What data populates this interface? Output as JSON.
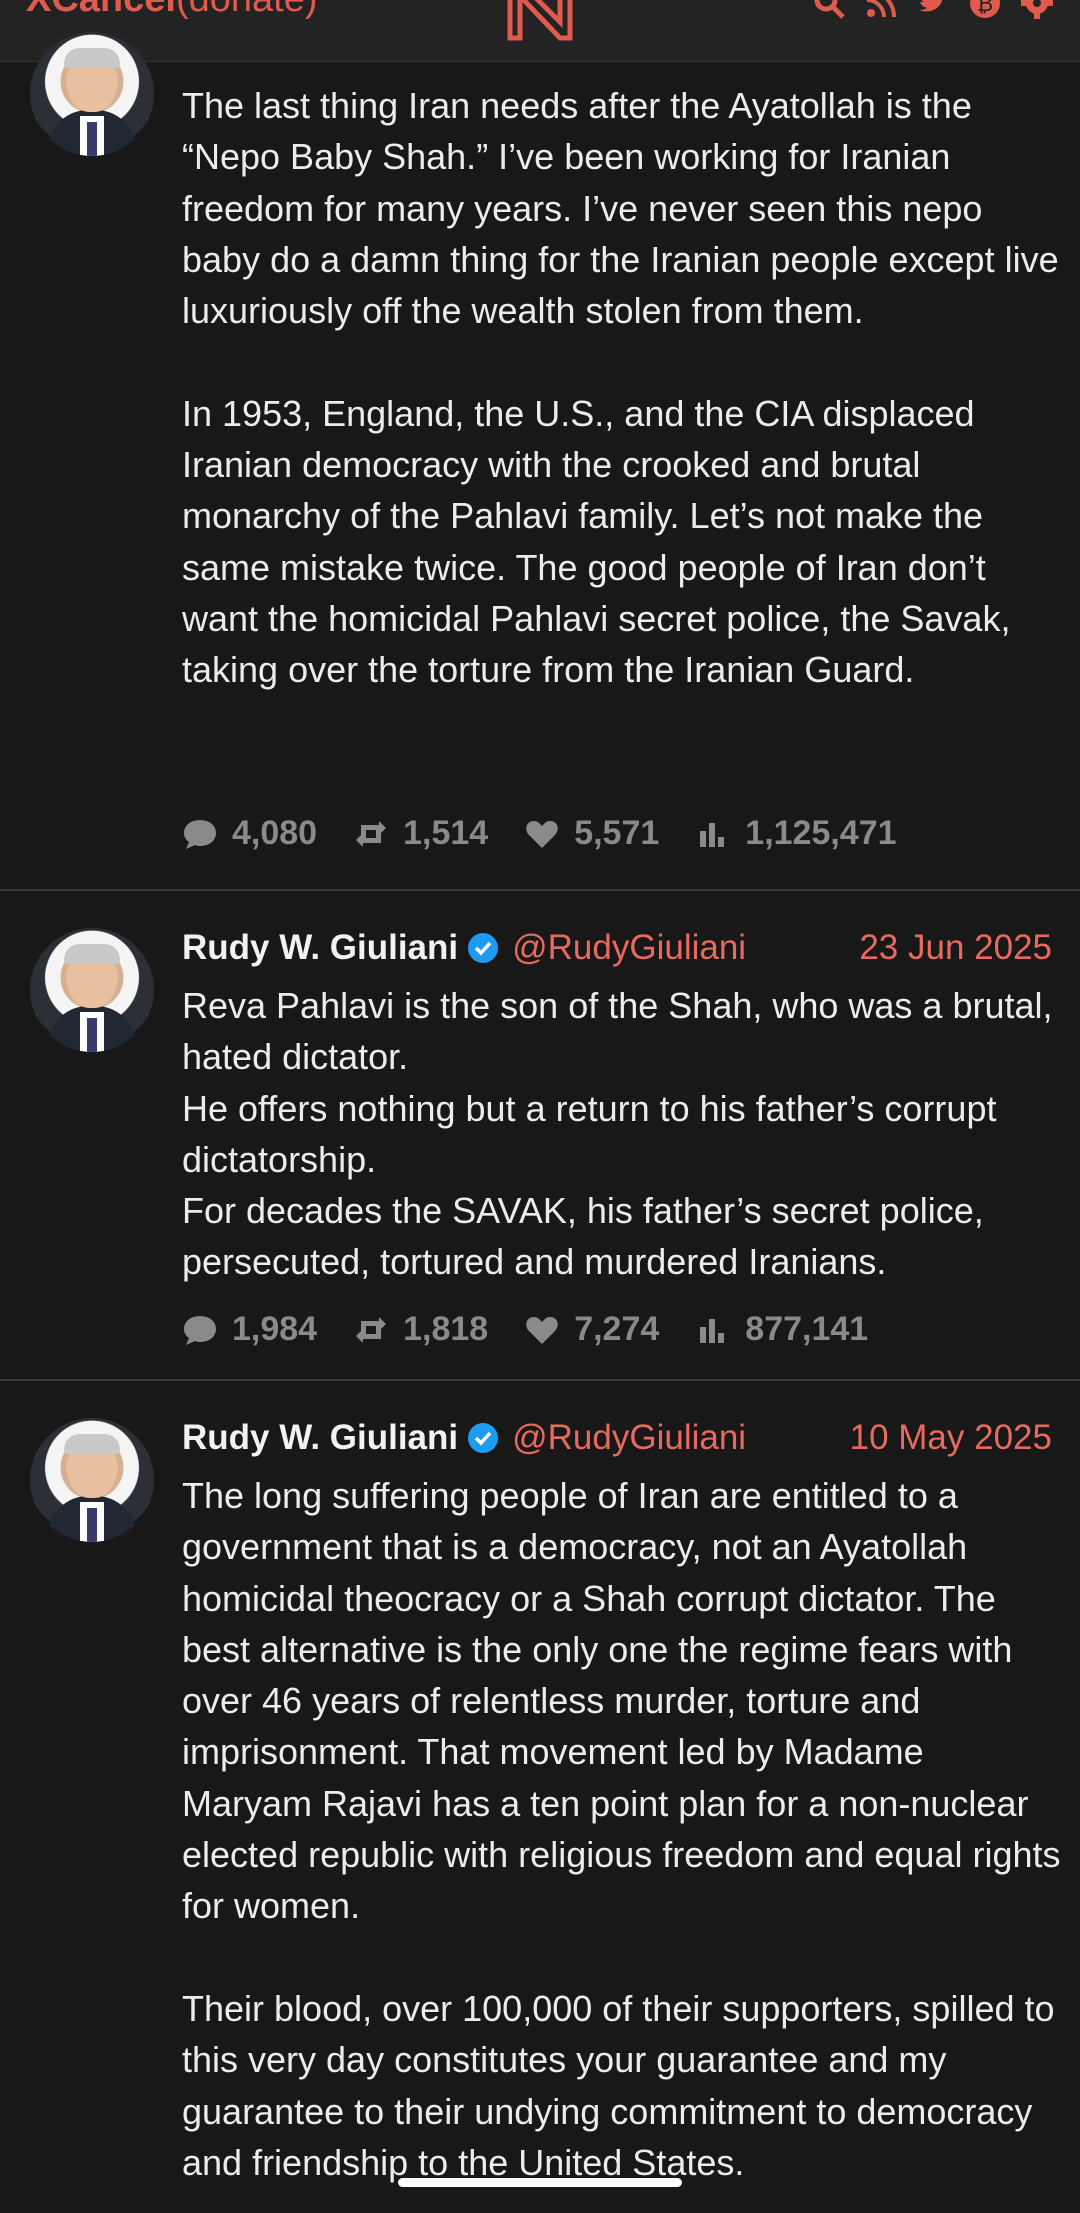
{
  "topbar": {
    "brand_main": "XCancel",
    "brand_donate": "(donate)",
    "icons": [
      "search-icon",
      "rss-icon",
      "twitter-icon",
      "bitcoin-icon",
      "settings-icon"
    ]
  },
  "tweets": [
    {
      "avatar": "rudy-giuliani-avatar",
      "body": "The last thing Iran needs after the Ayatollah is the “Nepo Baby Shah.” I’ve been working for Iranian freedom for many years. I’ve never seen this nepo baby do a damn thing for the Iranian people except live luxuriously off the wealth stolen from them.\n\nIn 1953, England, the U.S., and the CIA displaced Iranian democracy with the crooked and brutal monarchy of the Pahlavi family. Let’s not make the same mistake twice. The good people of Iran don’t want the homicidal Pahlavi secret police, the Savak, taking over the torture from the Iranian Guard.",
      "stats": {
        "comments": "4,080",
        "retweets": "1,514",
        "likes": "5,571",
        "views": "1,125,471"
      }
    },
    {
      "name": "Rudy W. Giuliani",
      "handle": "@RudyGiuliani",
      "date": "23 Jun 2025",
      "body": "Reva Pahlavi is the son of the Shah, who was a brutal, hated dictator.\nHe offers nothing but a return to his father’s corrupt dictatorship.\nFor decades the SAVAK, his father’s secret police, persecuted, tortured and murdered Iranians.",
      "stats": {
        "comments": "1,984",
        "retweets": "1,818",
        "likes": "7,274",
        "views": "877,141"
      }
    },
    {
      "name": "Rudy W. Giuliani",
      "handle": "@RudyGiuliani",
      "date": "10 May 2025",
      "body": "The long suffering people of Iran are entitled to a government that is a democracy, not an Ayatollah homicidal theocracy or a Shah corrupt dictator. The best alternative is the only one the regime fears with over 46 years of relentless murder, torture and imprisonment. That movement led by Madame Maryam Rajavi has a ten point plan for a non-nuclear elected republic with religious freedom and equal rights for women.\n\nTheir blood, over 100,000 of their supporters, spilled to this very day constitutes your guarantee and my guarantee to their undying commitment to democracy and friendship to the United States."
    }
  ]
}
